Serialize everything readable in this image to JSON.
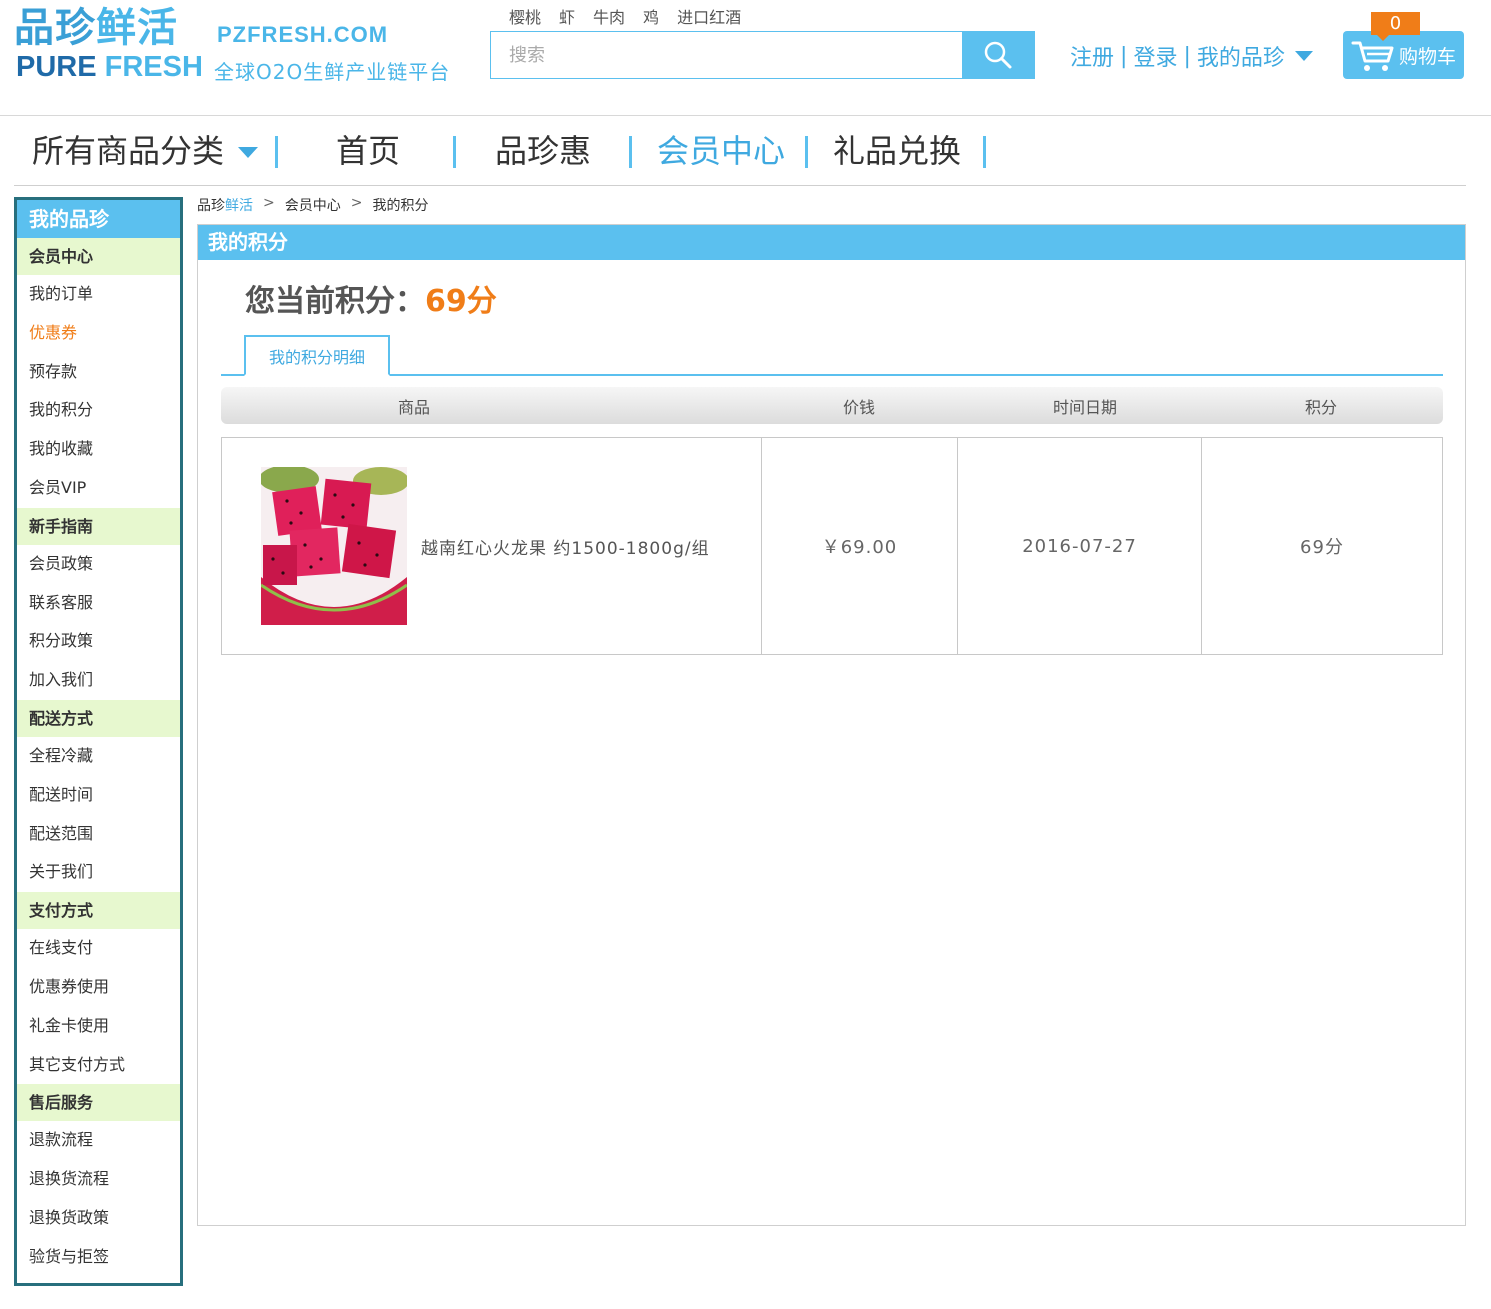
{
  "logo": {
    "cn_1": "品珍",
    "cn_2": "鲜活",
    "en_1": "PURE",
    "en_2": "FRESH",
    "domain": "PZFRESH.COM",
    "slogan": "全球O2O生鲜产业链平台"
  },
  "hotwords": [
    "樱桃",
    "虾",
    "牛肉",
    "鸡",
    "进口红酒"
  ],
  "search": {
    "placeholder": "搜索",
    "value": ""
  },
  "user_links": {
    "register": "注册",
    "separator": "|",
    "login": "登录",
    "my": "我的品珍"
  },
  "cart": {
    "count": "0",
    "label": "购物车"
  },
  "nav": {
    "all_categories": "所有商品分类",
    "home": "首页",
    "deals": "品珍惠",
    "member_center": "会员中心",
    "gift_exchange": "礼品兑换",
    "active": "会员中心"
  },
  "sidebar": {
    "title": "我的品珍",
    "sections": [
      {
        "title": "会员中心",
        "items": [
          "我的订单",
          "优惠券",
          "预存款",
          "我的积分",
          "我的收藏",
          "会员VIP"
        ]
      },
      {
        "title": "新手指南",
        "items": [
          "会员政策",
          "联系客服",
          "积分政策",
          "加入我们"
        ]
      },
      {
        "title": "配送方式",
        "items": [
          "全程冷藏",
          "配送时间",
          "配送范围",
          "关于我们"
        ]
      },
      {
        "title": "支付方式",
        "items": [
          "在线支付",
          "优惠券使用",
          "礼金卡使用",
          "其它支付方式"
        ]
      },
      {
        "title": "售后服务",
        "items": [
          "退款流程",
          "退换货流程",
          "退换货政策",
          "验货与拒签"
        ]
      }
    ],
    "highlight_item": "优惠券"
  },
  "breadcrumb": {
    "home_1": "品珍",
    "home_2": "鲜活",
    "arrow": ">",
    "level_2": "会员中心",
    "level_3": "我的积分"
  },
  "panel": {
    "title": "我的积分",
    "points_label": "您当前积分：",
    "points_value": "69分",
    "tab": "我的积分明细"
  },
  "table": {
    "headers": [
      "商品",
      "价钱",
      "时间日期",
      "积分"
    ],
    "rows": [
      {
        "product": "越南红心火龙果 约1500-1800g/组",
        "price": "￥69.00",
        "date": "2016-07-27",
        "points": "69分"
      }
    ]
  },
  "colors": {
    "accent": "#5bc0ef",
    "link": "#3fa9e0",
    "orange": "#f07d18",
    "sidebar_border": "#276f7d",
    "section_bg": "#e7f8cf"
  }
}
